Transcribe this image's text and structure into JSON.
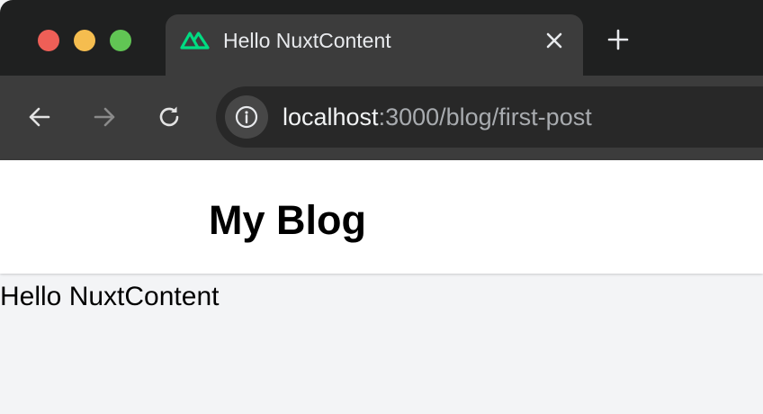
{
  "browser": {
    "tab": {
      "title": "Hello NuxtContent",
      "favicon": "nuxt-logo-icon"
    },
    "address_bar": {
      "host": "localhost",
      "path": ":3000/blog/first-post"
    },
    "icons": {
      "back": "arrow-left-icon",
      "forward": "arrow-right-icon",
      "reload": "reload-icon",
      "site_info": "info-icon",
      "tab_close": "close-icon",
      "new_tab": "plus-icon"
    },
    "colors": {
      "traffic_close": "#ee5f57",
      "traffic_minimize": "#f5bd4f",
      "traffic_maximize": "#61c554",
      "nuxt_green": "#00dc82"
    }
  },
  "page": {
    "header": {
      "title": "My Blog"
    },
    "content": {
      "text": "Hello NuxtContent"
    }
  }
}
